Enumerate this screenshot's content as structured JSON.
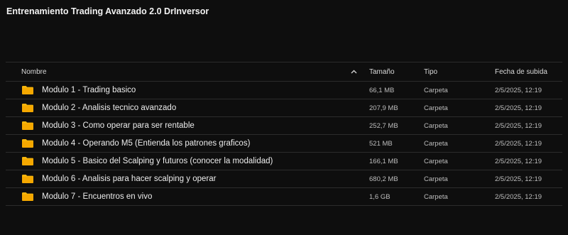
{
  "title": "Entrenamiento Trading Avanzado 2.0 DrInversor",
  "columns": {
    "name": "Nombre",
    "size": "Tamaño",
    "type": "Tipo",
    "date": "Fecha de subida"
  },
  "folder_color": "#f5b40b",
  "rows": [
    {
      "name": "Modulo 1 - Trading basico",
      "size": "66,1 MB",
      "type": "Carpeta",
      "date": "2/5/2025, 12:19"
    },
    {
      "name": "Modulo 2 - Analisis tecnico avanzado",
      "size": "207,9 MB",
      "type": "Carpeta",
      "date": "2/5/2025, 12:19"
    },
    {
      "name": "Modulo 3 - Como operar para ser rentable",
      "size": "252,7 MB",
      "type": "Carpeta",
      "date": "2/5/2025, 12:19"
    },
    {
      "name": "Modulo 4 - Operando M5 (Entienda los patrones graficos)",
      "size": "521 MB",
      "type": "Carpeta",
      "date": "2/5/2025, 12:19"
    },
    {
      "name": "Modulo 5 - Basico del Scalping y futuros (conocer la modalidad)",
      "size": "166,1 MB",
      "type": "Carpeta",
      "date": "2/5/2025, 12:19"
    },
    {
      "name": "Modulo 6 - Analisis para hacer scalping y operar",
      "size": "680,2 MB",
      "type": "Carpeta",
      "date": "2/5/2025, 12:19"
    },
    {
      "name": "Modulo 7 - Encuentros en vivo",
      "size": "1,6 GB",
      "type": "Carpeta",
      "date": "2/5/2025, 12:19"
    }
  ]
}
